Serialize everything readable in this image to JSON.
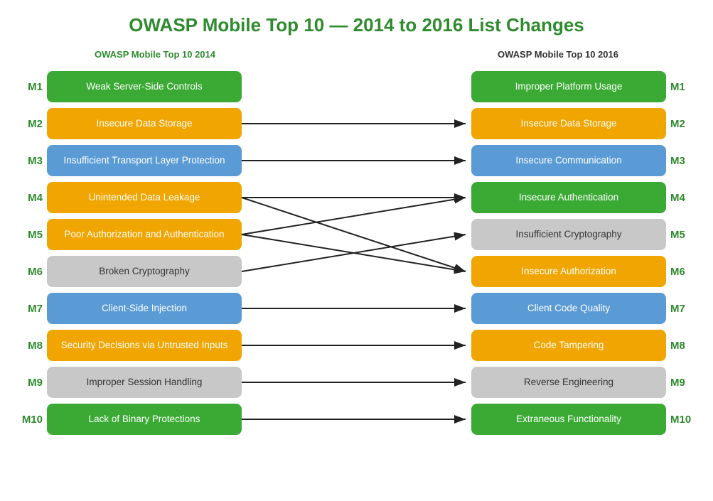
{
  "title": "OWASP Mobile Top 10 — 2014 to 2016 List Changes",
  "leftHeader": "OWASP Mobile Top 10 2014",
  "rightHeader": "OWASP Mobile Top 10 2016",
  "left": [
    {
      "label": "M1",
      "text": "Weak Server-Side Controls",
      "color": "green"
    },
    {
      "label": "M2",
      "text": "Insecure Data Storage",
      "color": "orange"
    },
    {
      "label": "M3",
      "text": "Insufficient Transport Layer Protection",
      "color": "blue"
    },
    {
      "label": "M4",
      "text": "Unintended Data Leakage",
      "color": "orange"
    },
    {
      "label": "M5",
      "text": "Poor Authorization and Authentication",
      "color": "orange"
    },
    {
      "label": "M6",
      "text": "Broken Cryptography",
      "color": "gray"
    },
    {
      "label": "M7",
      "text": "Client-Side Injection",
      "color": "blue"
    },
    {
      "label": "M8",
      "text": "Security Decisions via Untrusted Inputs",
      "color": "orange"
    },
    {
      "label": "M9",
      "text": "Improper Session Handling",
      "color": "gray"
    },
    {
      "label": "M10",
      "text": "Lack of Binary Protections",
      "color": "green"
    }
  ],
  "right": [
    {
      "label": "M1",
      "text": "Improper Platform Usage",
      "color": "green"
    },
    {
      "label": "M2",
      "text": "Insecure Data Storage",
      "color": "orange"
    },
    {
      "label": "M3",
      "text": "Insecure Communication",
      "color": "blue"
    },
    {
      "label": "M4",
      "text": "Insecure Authentication",
      "color": "green"
    },
    {
      "label": "M5",
      "text": "Insufficient Cryptography",
      "color": "gray"
    },
    {
      "label": "M6",
      "text": "Insecure Authorization",
      "color": "orange"
    },
    {
      "label": "M7",
      "text": "Client Code Quality",
      "color": "blue"
    },
    {
      "label": "M8",
      "text": "Code Tampering",
      "color": "orange"
    },
    {
      "label": "M9",
      "text": "Reverse Engineering",
      "color": "gray"
    },
    {
      "label": "M10",
      "text": "Extraneous Functionality",
      "color": "green"
    }
  ],
  "arrows": [
    {
      "from": 1,
      "to": 2,
      "note": "M2->M2"
    },
    {
      "from": 2,
      "to": 3,
      "note": "M3->M3"
    },
    {
      "from": 4,
      "to": 4,
      "note": "M4->M4"
    },
    {
      "from": 4,
      "to": 6,
      "note": "M5->M6"
    },
    {
      "from": 5,
      "to": 4,
      "note": "M5->M4"
    },
    {
      "from": 5,
      "to": 6,
      "note": "M5->M6"
    },
    {
      "from": 6,
      "to": 5,
      "note": "M6->M5"
    },
    {
      "from": 7,
      "to": 7,
      "note": "M7->M7"
    },
    {
      "from": 8,
      "to": 8,
      "note": "M8->M8"
    },
    {
      "from": 9,
      "to": 9,
      "note": "M9->M9"
    },
    {
      "from": 10,
      "to": 10,
      "note": "M10->M10"
    }
  ]
}
